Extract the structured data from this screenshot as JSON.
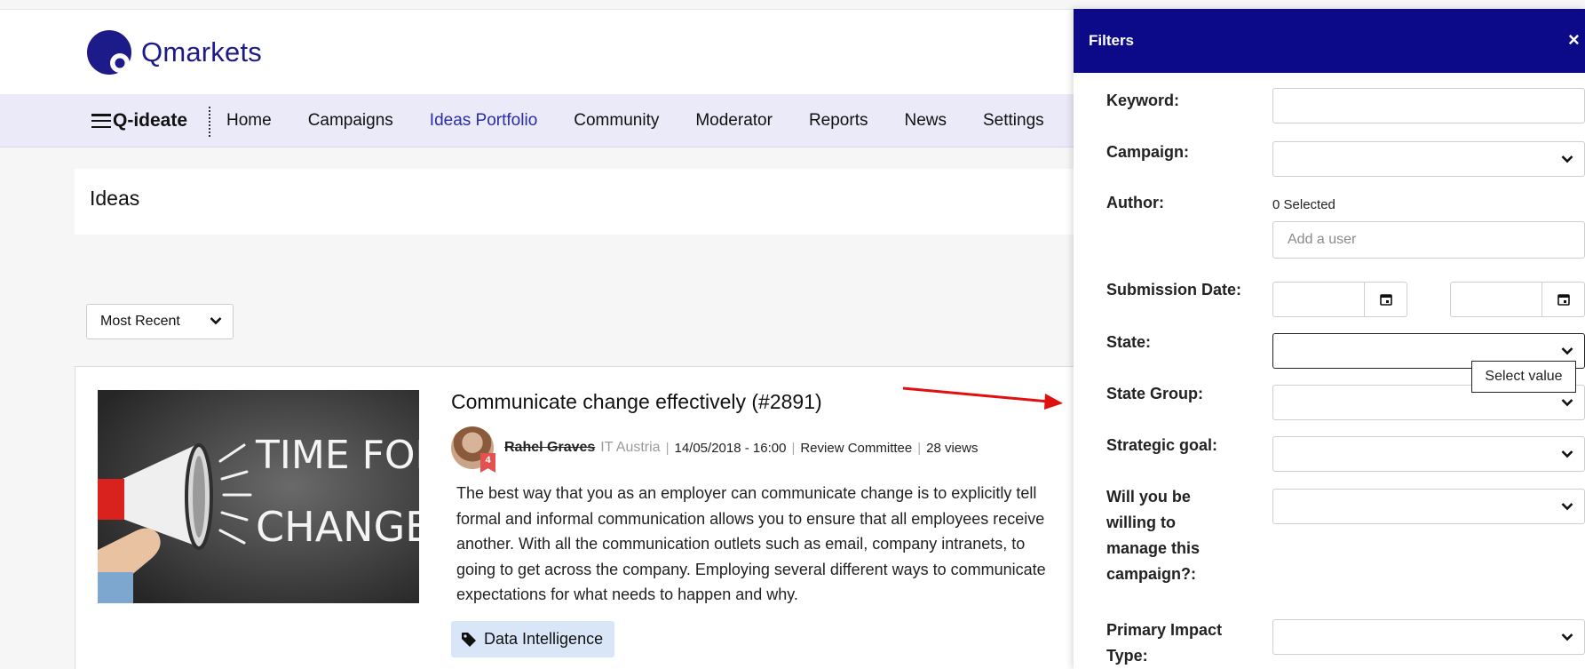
{
  "header": {
    "logo_text": "Qmarkets"
  },
  "nav": {
    "brand": "Q-ideate",
    "items": [
      {
        "label": "Home",
        "active": false
      },
      {
        "label": "Campaigns",
        "active": false
      },
      {
        "label": "Ideas Portfolio",
        "active": true
      },
      {
        "label": "Community",
        "active": false
      },
      {
        "label": "Moderator",
        "active": false
      },
      {
        "label": "Reports",
        "active": false
      },
      {
        "label": "News",
        "active": false
      },
      {
        "label": "Settings",
        "active": false
      }
    ]
  },
  "ideas": {
    "title": "Ideas",
    "sort": {
      "selected": "Most Recent"
    }
  },
  "idea": {
    "title": "Communicate change effectively (#2891)",
    "image_text": [
      "TIME FOR",
      "CHANGE"
    ],
    "author": "Rahel Graves",
    "org": "IT Austria",
    "date": "14/05/2018 - 16:00",
    "stage": "Review Committee",
    "views": "28 views",
    "badge_count": "4",
    "description_lines": [
      "The best way that you as an employer can communicate change is to explicitly tell",
      "formal and informal communication allows you to ensure that all employees receive",
      "another. With all the communication outlets such as email, company intranets, to",
      "going to get across the company. Employing several different ways to communicate",
      "expectations for what needs to happen and why."
    ],
    "tag": "Data Intelligence"
  },
  "filters": {
    "title": "Filters",
    "close": "×",
    "keyword": {
      "label": "Keyword:",
      "value": ""
    },
    "campaign": {
      "label": "Campaign:"
    },
    "author": {
      "label": "Author:",
      "selected_count": "0 Selected",
      "placeholder": "Add a user"
    },
    "submission_date": {
      "label": "Submission Date:"
    },
    "state": {
      "label": "State:",
      "tooltip": "Select value"
    },
    "state_group": {
      "label": "State Group:"
    },
    "strategic_goal": {
      "label": "Strategic goal:"
    },
    "willing": {
      "label_lines": [
        "Will you be",
        "willing to",
        "manage this",
        "campaign?:"
      ]
    },
    "impact": {
      "label_lines": [
        "Primary Impact",
        "Type:"
      ]
    }
  },
  "colors": {
    "brand": "#1d1a8a",
    "filters_header": "#0d0a8a",
    "nav_active": "#2b2ba6",
    "arrow": "#e01010"
  }
}
